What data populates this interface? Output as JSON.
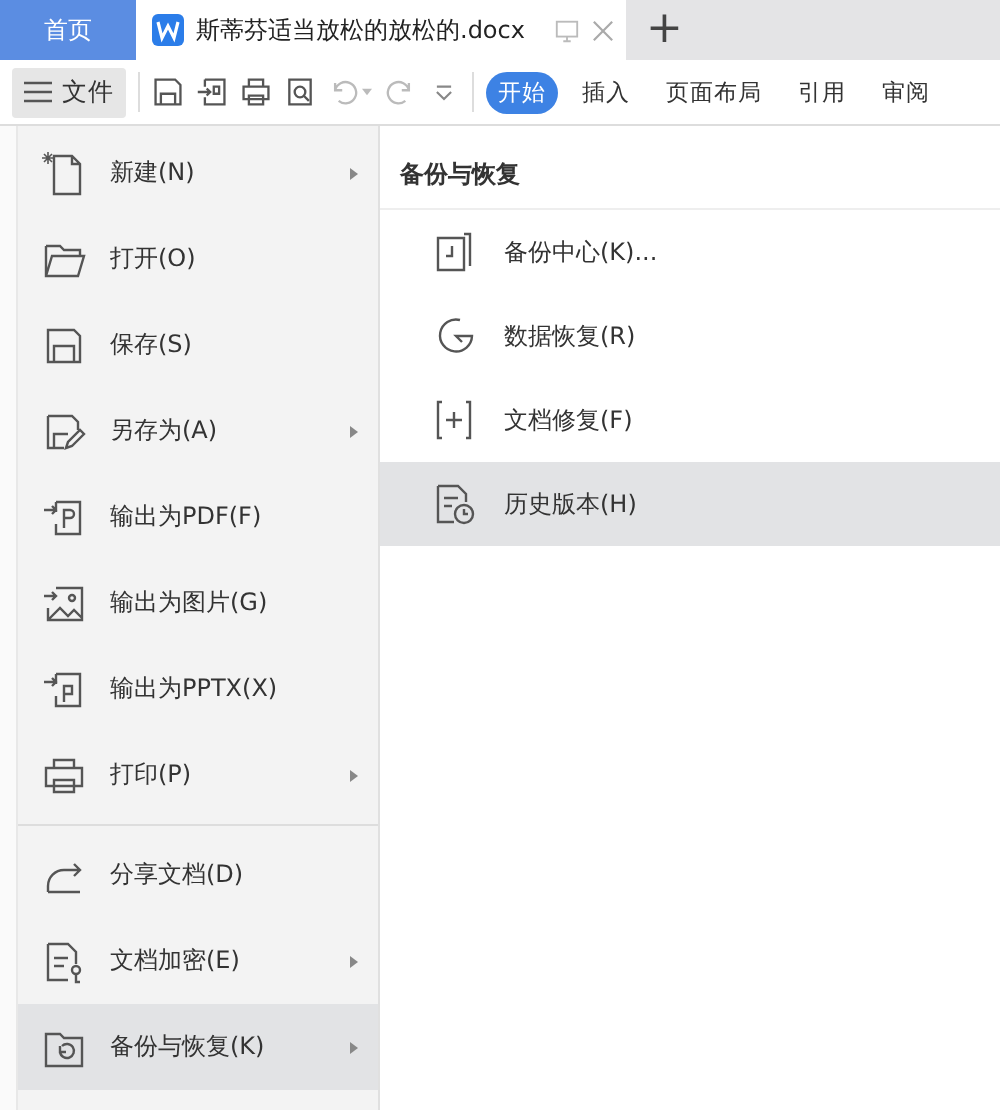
{
  "tab_bar": {
    "home_tab": {
      "label": "首页"
    },
    "document_tab": {
      "label": "斯蒂芬适当放松的放松的.docx",
      "selected": true
    },
    "new_tab_label": "+"
  },
  "toolbar": {
    "file_menu": {
      "label": "文件",
      "expanded": true
    },
    "ribbon_tabs": [
      {
        "label": "开始",
        "selected": true
      },
      {
        "label": "插入",
        "selected": false
      },
      {
        "label": "页面布局",
        "selected": false
      },
      {
        "label": "引用",
        "selected": false
      },
      {
        "label": "审阅",
        "selected": false
      }
    ]
  },
  "file_menu": {
    "groups": [
      [
        {
          "label": "新建(N)",
          "submenu": true,
          "selected": false
        },
        {
          "label": "打开(O)",
          "submenu": false,
          "selected": false
        },
        {
          "label": "保存(S)",
          "submenu": false,
          "selected": false
        },
        {
          "label": "另存为(A)",
          "submenu": true,
          "selected": false
        },
        {
          "label": "输出为PDF(F)",
          "submenu": false,
          "selected": false
        },
        {
          "label": "输出为图片(G)",
          "submenu": false,
          "selected": false
        },
        {
          "label": "输出为PPTX(X)",
          "submenu": false,
          "selected": false
        },
        {
          "label": "打印(P)",
          "submenu": true,
          "selected": false
        }
      ],
      [
        {
          "label": "分享文档(D)",
          "submenu": false,
          "selected": false
        },
        {
          "label": "文档加密(E)",
          "submenu": true,
          "selected": false
        },
        {
          "label": "备份与恢复(K)",
          "submenu": true,
          "selected": true
        }
      ]
    ]
  },
  "submenu": {
    "title": "备份与恢复",
    "items": [
      {
        "label": "备份中心(K)...",
        "selected": false
      },
      {
        "label": "数据恢复(R)",
        "selected": false
      },
      {
        "label": "文档修复(F)",
        "selected": false
      },
      {
        "label": "历史版本(H)",
        "selected": true
      }
    ]
  }
}
